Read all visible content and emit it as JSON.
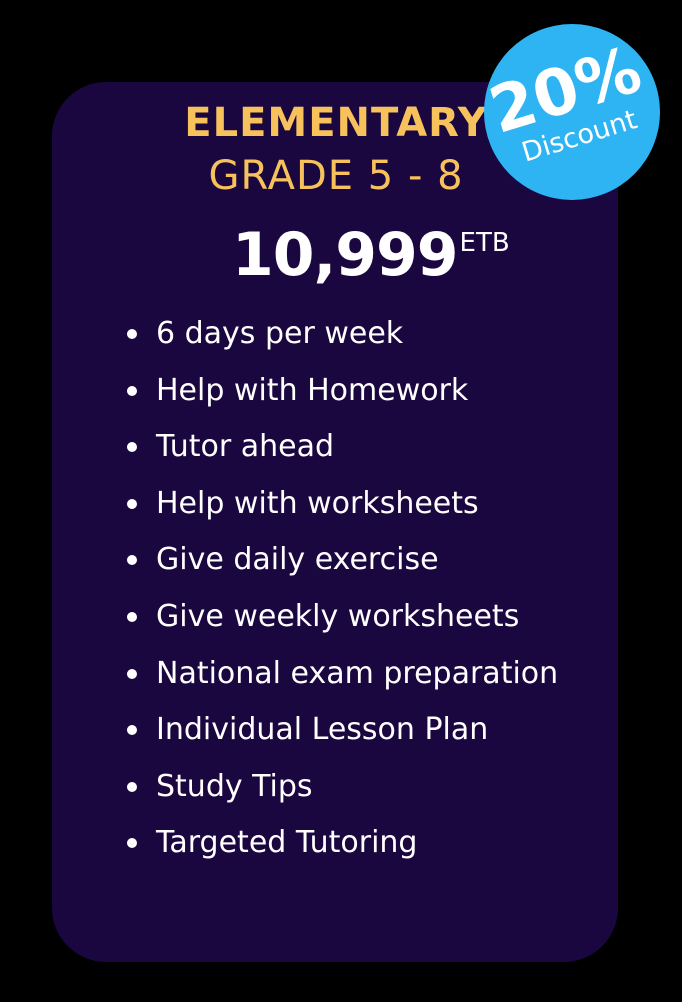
{
  "plan": {
    "title": "ELEMENTARY",
    "subtitle": "GRADE 5 - 8",
    "price": "10,999",
    "currency": "ETB"
  },
  "badge": {
    "percent": "20%",
    "label": "Discount"
  },
  "features": [
    "6 days per week",
    "Help with Homework",
    "Tutor ahead",
    "Help with worksheets",
    "Give daily exercise",
    "Give weekly worksheets",
    "National exam preparation",
    "Individual Lesson Plan",
    "Study Tips",
    "Targeted Tutoring"
  ],
  "colors": {
    "background": "#000000",
    "card": "#1a0740",
    "accent": "#f7c25c",
    "badge": "#2eb4f3",
    "text": "#ffffff"
  }
}
